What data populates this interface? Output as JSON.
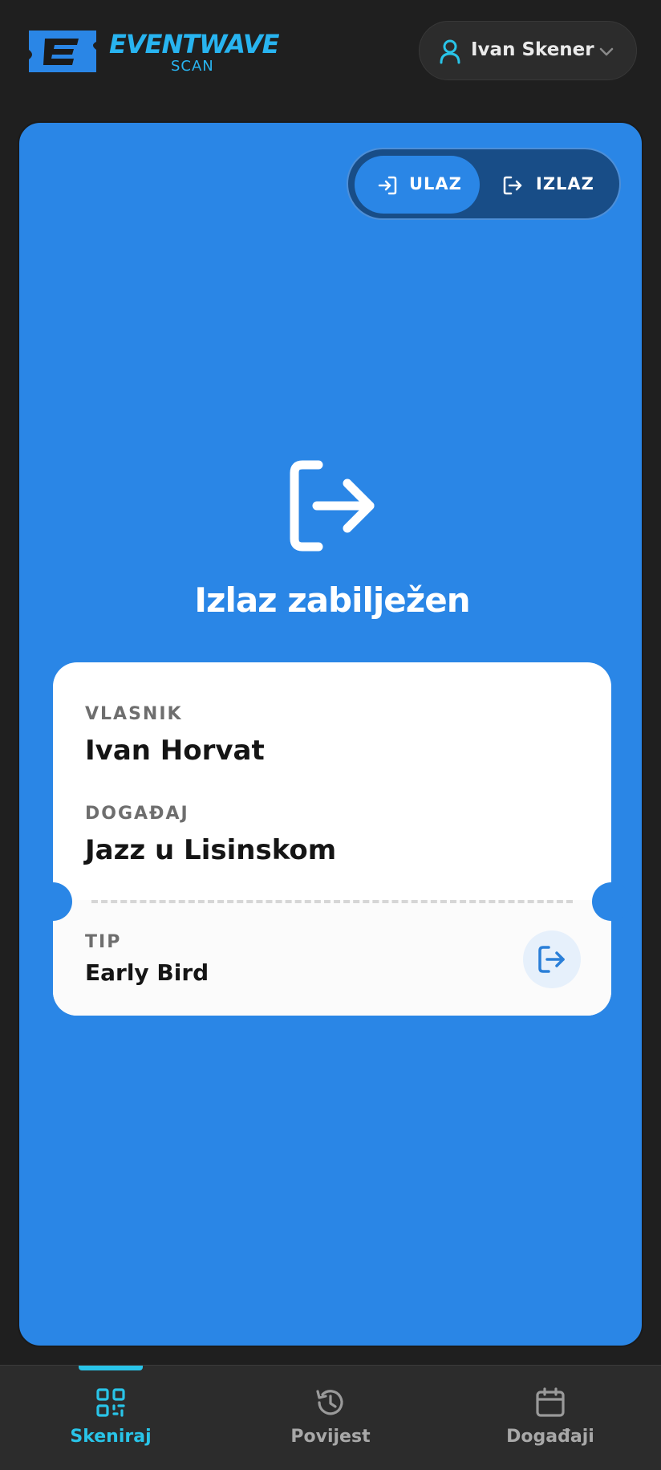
{
  "brand": {
    "name": "EVENTWAVE",
    "sub": "SCAN"
  },
  "user": {
    "name": "Ivan Skener"
  },
  "toggle": {
    "in_label": "ULAZ",
    "out_label": "IZLAZ"
  },
  "result": {
    "title": "Izlaz zabilježen"
  },
  "ticket": {
    "owner_label": "VLASNIK",
    "owner": "Ivan Horvat",
    "event_label": "DOGAĐAJ",
    "event": "Jazz u Lisinskom",
    "type_label": "TIP",
    "type": "Early Bird"
  },
  "nav": {
    "scan": "Skeniraj",
    "history": "Povijest",
    "events": "Događaji"
  },
  "colors": {
    "accent": "#2a86e6",
    "nav_active": "#29c4e8"
  }
}
